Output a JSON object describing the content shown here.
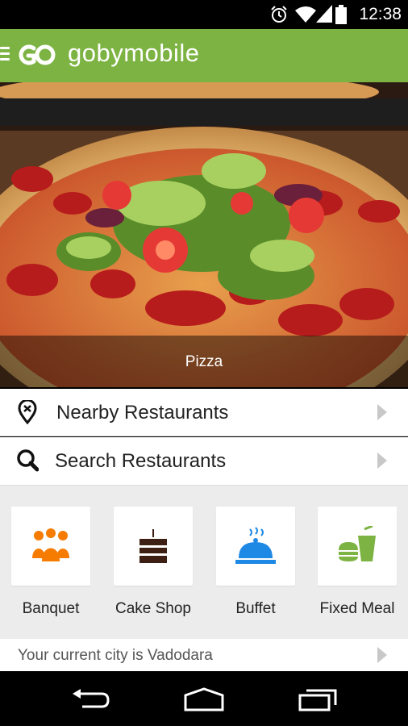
{
  "status_bar": {
    "time": "12:38",
    "icons": [
      "alarm-icon",
      "wifi-icon",
      "signal-icon",
      "battery-icon"
    ]
  },
  "app_bar": {
    "brand": "gobymobile",
    "icons": [
      "menu-icon",
      "logo-icon"
    ],
    "color": "#7cb342"
  },
  "hero": {
    "caption": "Pizza"
  },
  "menu": {
    "nearby_label": "Nearby Restaurants",
    "search_label": "Search Restaurants"
  },
  "categories": [
    {
      "label": "Banquet",
      "icon": "banquet-icon",
      "color": "#f57c00"
    },
    {
      "label": "Cake Shop",
      "icon": "cake-icon",
      "color": "#3e1f14"
    },
    {
      "label": "Buffet",
      "icon": "buffet-icon",
      "color": "#1e88e5"
    },
    {
      "label": "Fixed Meal",
      "icon": "fixed-meal-icon",
      "color": "#7cb342"
    }
  ],
  "city": {
    "text": "Your current city is Vadodara"
  },
  "nav_bar": {
    "icons": [
      "back-icon",
      "home-icon",
      "recent-apps-icon"
    ]
  }
}
